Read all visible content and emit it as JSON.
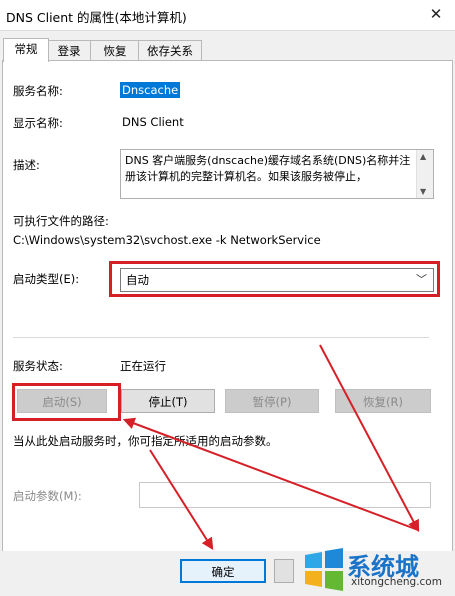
{
  "window": {
    "title": "DNS Client 的属性(本地计算机)",
    "close_glyph": "✕"
  },
  "tabs": [
    {
      "label": "常规"
    },
    {
      "label": "登录"
    },
    {
      "label": "恢复"
    },
    {
      "label": "依存关系"
    }
  ],
  "general": {
    "service_name_label": "服务名称:",
    "service_name_value": "Dnscache",
    "display_name_label": "显示名称:",
    "display_name_value": "DNS Client",
    "description_label": "描述:",
    "description_value": "DNS 客户端服务(dnscache)缓存域名系统(DNS)名称并注册该计算机的完整计算机名。如果该服务被停止，",
    "exe_path_label": "可执行文件的路径:",
    "exe_path_value": "C:\\Windows\\system32\\svchost.exe -k NetworkService",
    "startup_type_label": "启动类型(E):",
    "startup_type_value": "自动",
    "service_status_label": "服务状态:",
    "service_status_value": "正在运行",
    "start_button": "启动(S)",
    "stop_button": "停止(T)",
    "pause_button": "暂停(P)",
    "resume_button": "恢复(R)",
    "hint_text": "当从此处启动服务时，你可指定所适用的启动参数。",
    "start_params_label": "启动参数(M):",
    "start_params_value": ""
  },
  "footer": {
    "ok_button": "确定"
  },
  "watermark": {
    "brand": "系统城",
    "url": "xitongcheng.com"
  },
  "colors": {
    "annotation_red": "#d61f26",
    "selection_blue": "#0078d7"
  }
}
